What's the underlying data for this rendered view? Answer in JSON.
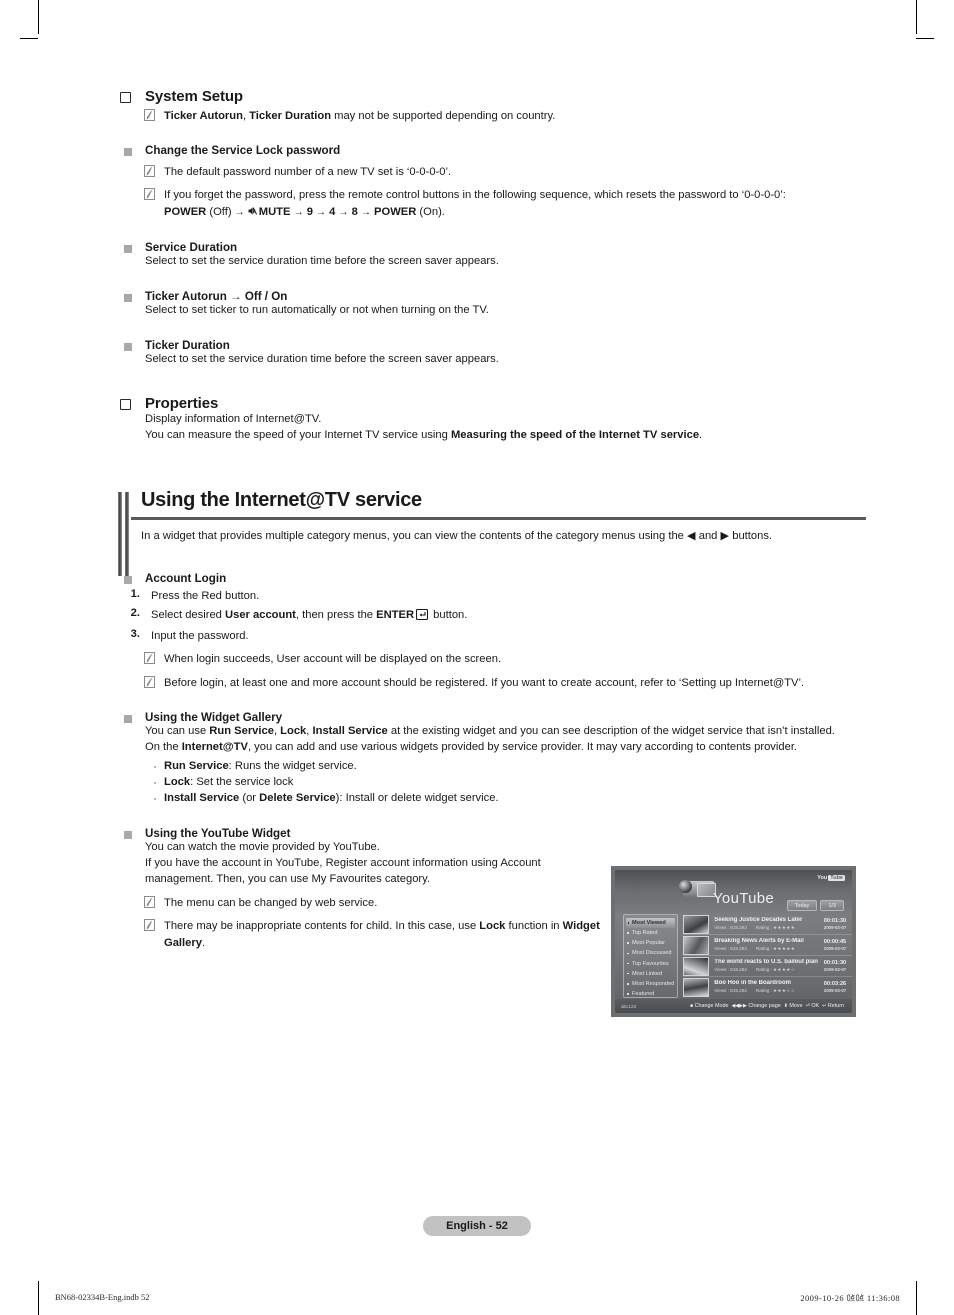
{
  "doc": {
    "page_badge": "English - 52",
    "print_left": "BN68-02334B-Eng.indb   52",
    "print_right": "2009-10-26   ㍘㍘ 11:36:08"
  },
  "system_setup": {
    "title": "System Setup",
    "note": "Ticker Autorun, Ticker Duration may not be supported depending on country.",
    "note_bold_1": "Ticker Autorun",
    "note_bold_2": "Ticker Duration"
  },
  "change_password": {
    "title": "Change the Service Lock password",
    "note_1": "The default password number of a new TV set is ‘0-0-0-0’.",
    "note_2": "If you forget the password, press the remote control buttons in the following sequence, which resets the password to ‘0-0-0-0’:",
    "sequence": {
      "power_off_label": "POWER",
      "power_off_state": "(Off)",
      "mute_label": "MUTE",
      "num_1": "9",
      "num_2": "4",
      "num_3": "8",
      "power_on_label": "POWER",
      "power_on_state": "(On).",
      "arrow": "→"
    }
  },
  "service_duration": {
    "title": "Service Duration",
    "body": "Select to set the service duration time before the screen saver appears."
  },
  "ticker_autorun": {
    "title": "Ticker Autorun → Off / On",
    "body": "Select to set ticker to run automatically or not when turning on the TV."
  },
  "ticker_duration": {
    "title": "Ticker Duration",
    "body": "Select to set the service duration time before the screen saver appears."
  },
  "properties": {
    "title": "Properties",
    "line_1": "Display information of Internet@TV.",
    "line_2_pre": "You can measure the speed of your Internet TV service using ",
    "line_2_bold": "Measuring the speed of the Internet TV service",
    "line_2_post": "."
  },
  "section": {
    "title": "Using the Internet@TV service",
    "lead_pre": "In a widget that provides multiple category menus, you can view the contents of the category menus using the ",
    "lead_left_arrow": "◀",
    "lead_mid": " and ",
    "lead_right_arrow": "▶",
    "lead_post": " buttons."
  },
  "account_login": {
    "title": "Account Login",
    "steps": [
      {
        "num": "1.",
        "text": "Press the Red button."
      },
      {
        "num": "2.",
        "text": "Select desired User account, then press the ENTER button."
      },
      {
        "num": "3.",
        "text": "Input the password."
      }
    ],
    "step2_pre": "Select desired ",
    "step2_bold": "User account",
    "step2_mid": ", then press the ",
    "step2_enter": "ENTER",
    "step2_post": " button.",
    "note_1": "When login succeeds, User account will be displayed on the screen.",
    "note_2": "Before login, at least one and more account should be registered. If you want to create account, refer to ‘Setting up Internet@TV’."
  },
  "widget_gallery": {
    "title": "Using the Widget Gallery",
    "p1_pre": "You can use ",
    "p1_b1": "Run Service",
    "p1_s1": ", ",
    "p1_b2": "Lock",
    "p1_s2": ", ",
    "p1_b3": "Install Service",
    "p1_post": " at the existing widget and you can see description of the widget service that isn’t installed.",
    "p2_pre": "On the ",
    "p2_bold": "Internet@TV",
    "p2_post": ", you can add and use various widgets provided by service provider. It may vary according to contents provider.",
    "bullets": [
      {
        "bold": "Run Service",
        "rest": ": Runs the widget service."
      },
      {
        "bold": "Lock",
        "rest": ": Set the service lock"
      },
      {
        "bold": "Install Service",
        "rest": ": Install or delete widget service.",
        "paren_pre": " (or ",
        "paren_bold": "Delete Service",
        "paren_post": ")"
      }
    ]
  },
  "youtube_widget": {
    "title": "Using the YouTube Widget",
    "line_1": "You can watch the movie provided by YouTube.",
    "line_2": "If you have the account in YouTube, Register account information using Account management. Then, you can use My Favourites category.",
    "note_1": "The menu can be changed by web service.",
    "note_2_pre": "There may be inappropriate contents for child. In this case, use ",
    "note_2_b1": "Lock",
    "note_2_mid": " function in ",
    "note_2_b2": "Widget Gallery",
    "note_2_post": "."
  },
  "screenshot": {
    "brand": "You",
    "brand_box": "Tube",
    "heading": "YouTube",
    "pills": [
      "Today",
      "1/3"
    ],
    "menu": [
      "Most Viewed",
      "Top Rated",
      "Most Popular",
      "Most Discussed",
      "Top Favourites",
      "Most Linked",
      "Most Responded",
      "Featured"
    ],
    "menu_selected": "Most Viewed",
    "menu_more": "⌵",
    "videos": [
      {
        "title": "Seeking Justice Decades Later",
        "views": "Views : 819,262",
        "rating": "Rating : ",
        "stars": "★★★★★",
        "duration": "00:01:30",
        "date": "2009-03-07"
      },
      {
        "title": "Breaking News Alerts by E-Mail",
        "views": "Views : 819,262",
        "rating": "Rating : ",
        "stars": "★★★★★",
        "duration": "00:00:45",
        "date": "2009-03-07"
      },
      {
        "title": "The world reacts to U.S. bailout plan",
        "views": "Views : 819,262",
        "rating": "Rating : ",
        "stars": "★★★★☆",
        "duration": "00:01:30",
        "date": "2009-03-07"
      },
      {
        "title": "Boo Hoo in the Boardroom",
        "views": "Views : 819,262",
        "rating": "Rating : ",
        "stars": "★★★☆☆",
        "duration": "00:03:26",
        "date": "2009-03-07"
      }
    ],
    "footer_left": "abc123",
    "footer_change_mode": "Change Mode",
    "footer_change_page": "Change page",
    "footer_move": "Move",
    "footer_ok": "OK",
    "footer_return": "Return"
  }
}
